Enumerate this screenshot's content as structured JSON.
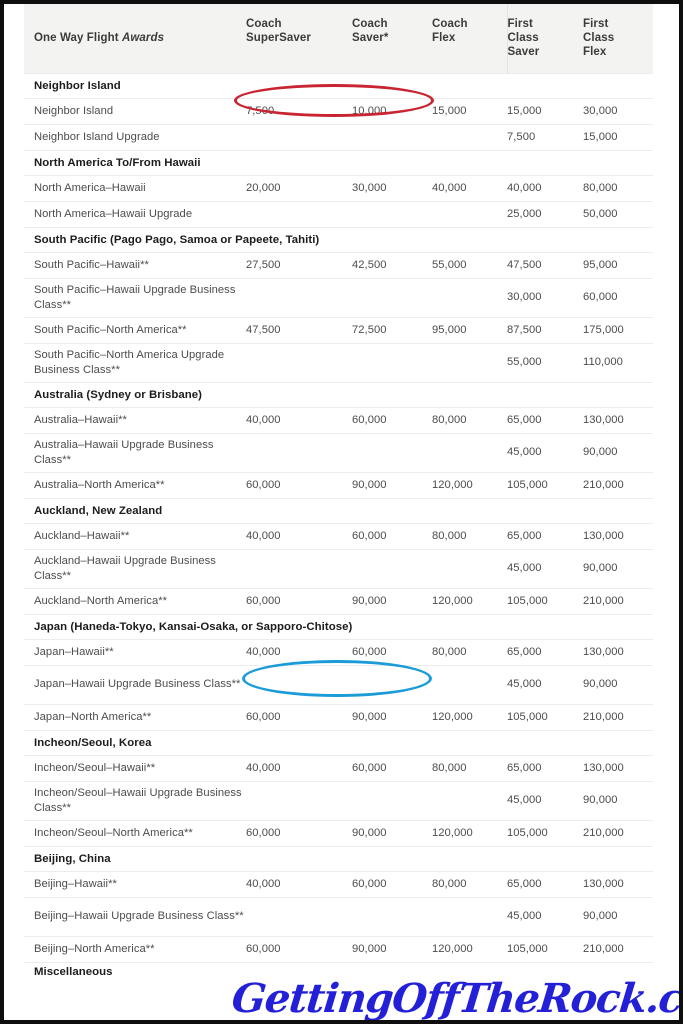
{
  "document": {
    "title": "One Way Flight Awards",
    "watermark": "GettingOffTheRock.com"
  },
  "table": {
    "headers": {
      "route": "One Way Flight ",
      "route_italic": "Awards",
      "coach_supersaver": "Coach\nSuperSaver",
      "coach_saver": "Coach\nSaver*",
      "coach_flex": "Coach\nFlex",
      "first_class_saver": "First\nClass\nSaver",
      "first_class_flex": "First\nClass\nFlex"
    },
    "column_labels": [
      "One Way Flight Awards",
      "Coach SuperSaver",
      "Coach Saver*",
      "Coach Flex",
      "First Class Saver",
      "First Class Flex"
    ],
    "rows": [
      {
        "type": "section",
        "label": "Neighbor Island"
      },
      {
        "type": "data",
        "lines": 1,
        "route": "Neighbor Island",
        "values": [
          "7,500",
          "10,000",
          "15,000",
          "15,000",
          "30,000"
        ]
      },
      {
        "type": "data",
        "lines": 1,
        "route": "Neighbor Island Upgrade",
        "values": [
          "",
          "",
          "",
          "7,500",
          "15,000"
        ]
      },
      {
        "type": "section",
        "label": "North America To/From Hawaii"
      },
      {
        "type": "data",
        "lines": 1,
        "route": "North America–Hawaii",
        "values": [
          "20,000",
          "30,000",
          "40,000",
          "40,000",
          "80,000"
        ]
      },
      {
        "type": "data",
        "lines": 1,
        "route": "North America–Hawaii Upgrade",
        "values": [
          "",
          "",
          "",
          "25,000",
          "50,000"
        ]
      },
      {
        "type": "section",
        "label": "South Pacific (Pago Pago, Samoa or Papeete, Tahiti)"
      },
      {
        "type": "data",
        "lines": 1,
        "route": "South Pacific–Hawaii**",
        "values": [
          "27,500",
          "42,500",
          "55,000",
          "47,500",
          "95,000"
        ]
      },
      {
        "type": "data",
        "lines": 2,
        "route": "South Pacific–Hawaii Upgrade Business Class**",
        "values": [
          "",
          "",
          "",
          "30,000",
          "60,000"
        ]
      },
      {
        "type": "data",
        "lines": 1,
        "route": "South Pacific–North America**",
        "values": [
          "47,500",
          "72,500",
          "95,000",
          "87,500",
          "175,000"
        ]
      },
      {
        "type": "data",
        "lines": 2,
        "route": "South Pacific–North America Upgrade Business Class**",
        "values": [
          "",
          "",
          "",
          "55,000",
          "110,000"
        ]
      },
      {
        "type": "section",
        "label": "Australia (Sydney or Brisbane)"
      },
      {
        "type": "data",
        "lines": 1,
        "route": "Australia–Hawaii**",
        "values": [
          "40,000",
          "60,000",
          "80,000",
          "65,000",
          "130,000"
        ]
      },
      {
        "type": "data",
        "lines": 2,
        "route": "Australia–Hawaii Upgrade Business Class**",
        "values": [
          "",
          "",
          "",
          "45,000",
          "90,000"
        ]
      },
      {
        "type": "data",
        "lines": 1,
        "route": "Australia–North America**",
        "values": [
          "60,000",
          "90,000",
          "120,000",
          "105,000",
          "210,000"
        ]
      },
      {
        "type": "section",
        "label": "Auckland, New Zealand"
      },
      {
        "type": "data",
        "lines": 1,
        "route": "Auckland–Hawaii**",
        "values": [
          "40,000",
          "60,000",
          "80,000",
          "65,000",
          "130,000"
        ]
      },
      {
        "type": "data",
        "lines": 2,
        "route": "Auckland–Hawaii Upgrade Business Class**",
        "values": [
          "",
          "",
          "",
          "45,000",
          "90,000"
        ]
      },
      {
        "type": "data",
        "lines": 1,
        "route": "Auckland–North America**",
        "values": [
          "60,000",
          "90,000",
          "120,000",
          "105,000",
          "210,000"
        ]
      },
      {
        "type": "section",
        "label": "Japan (Haneda-Tokyo, Kansai-Osaka, or Sapporo-Chitose)"
      },
      {
        "type": "data",
        "lines": 1,
        "route": "Japan–Hawaii**",
        "values": [
          "40,000",
          "60,000",
          "80,000",
          "65,000",
          "130,000"
        ]
      },
      {
        "type": "data",
        "lines": 2,
        "route": "Japan–Hawaii Upgrade Business Class**",
        "values": [
          "",
          "",
          "",
          "45,000",
          "90,000"
        ]
      },
      {
        "type": "data",
        "lines": 1,
        "route": "Japan–North America**",
        "values": [
          "60,000",
          "90,000",
          "120,000",
          "105,000",
          "210,000"
        ]
      },
      {
        "type": "section",
        "label": "Incheon/Seoul, Korea"
      },
      {
        "type": "data",
        "lines": 1,
        "route": "Incheon/Seoul–Hawaii**",
        "values": [
          "40,000",
          "60,000",
          "80,000",
          "65,000",
          "130,000"
        ]
      },
      {
        "type": "data",
        "lines": 2,
        "route": "Incheon/Seoul–Hawaii Upgrade Business Class**",
        "values": [
          "",
          "",
          "",
          "45,000",
          "90,000"
        ]
      },
      {
        "type": "data",
        "lines": 1,
        "route": "Incheon/Seoul–North America**",
        "values": [
          "60,000",
          "90,000",
          "120,000",
          "105,000",
          "210,000"
        ]
      },
      {
        "type": "section",
        "label": "Beijing, China"
      },
      {
        "type": "data",
        "lines": 1,
        "route": "Beijing–Hawaii**",
        "values": [
          "40,000",
          "60,000",
          "80,000",
          "65,000",
          "130,000"
        ]
      },
      {
        "type": "data",
        "lines": 2,
        "route": "Beijing–Hawaii Upgrade Business Class**",
        "values": [
          "",
          "",
          "",
          "45,000",
          "90,000"
        ]
      },
      {
        "type": "data",
        "lines": 1,
        "route": "Beijing–North America**",
        "values": [
          "60,000",
          "90,000",
          "120,000",
          "105,000",
          "210,000"
        ]
      },
      {
        "type": "partial",
        "label": "Miscellaneous"
      }
    ]
  },
  "annotations": [
    {
      "id": "ellipse-red",
      "shape": "ellipse",
      "color": "#c92432",
      "highlights": "Neighbor Island Coach SuperSaver 7,500 and Coach Saver 10,000"
    },
    {
      "id": "ellipse-blue",
      "shape": "ellipse",
      "color": "#1b9bd8",
      "highlights": "Japan–Hawaii Coach SuperSaver 40,000 and Coach Saver 60,000"
    }
  ]
}
